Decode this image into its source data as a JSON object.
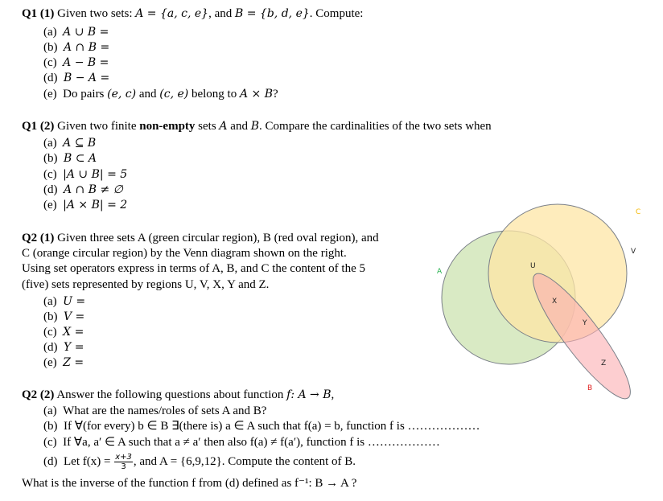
{
  "q1_1": {
    "heading_bold": "Q1 (1)",
    "heading_text": " Given two sets: ",
    "set_a": "A = {a, c, e}",
    "set_join": ", and ",
    "set_b": "B = {b, d, e}",
    "heading_tail": ". Compute:",
    "items": [
      {
        "label": "(a)",
        "expr": "A ∪ B ="
      },
      {
        "label": "(b)",
        "expr": "A ∩ B ="
      },
      {
        "label": "(c)",
        "expr": "A − B ="
      },
      {
        "label": "(d)",
        "expr": "B − A ="
      },
      {
        "label": "(e)",
        "text_pre": "Do pairs ",
        "pair1": "(e, c)",
        "text_mid": " and ",
        "pair2": "(c, e)",
        "text_post": " belong to ",
        "expr": "A × B",
        "end": "?"
      }
    ]
  },
  "q1_2": {
    "heading_bold": "Q1 (2)",
    "heading_text": " Given two finite ",
    "heading_emph": "non-empty",
    "heading_text2": " sets ",
    "var_a": "A",
    "and": " and ",
    "var_b": "B",
    "heading_tail": ". Compare the cardinalities  of the two sets when",
    "items": [
      {
        "label": "(a)",
        "expr": "A ⊆ B"
      },
      {
        "label": "(b)",
        "expr": "B ⊂ A"
      },
      {
        "label": "(c)",
        "expr": "|A ∪ B| = 5"
      },
      {
        "label": "(d)",
        "expr": "A ∩ B ≠ ∅"
      },
      {
        "label": "(e)",
        "expr": "|A × B| =  2"
      }
    ]
  },
  "q2_1": {
    "heading_bold": "Q2 (1)",
    "line1": " Given three sets A (green circular region),  B (red oval region),  and",
    "line2": "C (orange circular  region) by the Venn diagram  shown on the right.",
    "line3": "Using set operators express in terms of A, B, and C the content of the 5",
    "line4": "(five) sets represented by regions  U, V, X, Y and Z.",
    "items": [
      {
        "label": "(a)",
        "expr": "U ="
      },
      {
        "label": "(b)",
        "expr": "V ="
      },
      {
        "label": "(c)",
        "expr": "X ="
      },
      {
        "label": "(d)",
        "expr": "Y ="
      },
      {
        "label": "(e)",
        "expr": "Z ="
      }
    ]
  },
  "venn": {
    "sets": [
      {
        "name": "A",
        "description": "green circular region",
        "fill": "#d9eac4",
        "label_color": "#22b04b"
      },
      {
        "name": "B",
        "description": "red oval region",
        "fill": "#fcaeb0",
        "label_color": "#e0201f"
      },
      {
        "name": "C",
        "description": "orange circular region",
        "fill": "#fde6a6",
        "label_color": "#f5b800"
      }
    ],
    "regions": [
      "U",
      "V",
      "X",
      "Y",
      "Z"
    ],
    "outline_color": "#7a7f88"
  },
  "q2_2": {
    "heading_bold": "Q2 (2)",
    "heading_text": " Answer the following  questions about function ",
    "func": "f: A → B",
    "heading_tail": ",",
    "item_a": {
      "label": "(a)",
      "text": "What are the names/roles  of sets A and B?"
    },
    "item_b": {
      "label": "(b)",
      "text": "If ∀(for every) b ∈ B ∃(there is) a ∈ A such that f(a)  = b, function f is ",
      "blank": "………………"
    },
    "item_c": {
      "label": "(c)",
      "text": "If ∀a, a′ ∈ A such that a ≠ a′ then also f(a) ≠ f(a′), function f is ",
      "blank": "………………"
    },
    "item_d": {
      "label": "(d)",
      "pre": "Let f(x) = ",
      "num": "x+3",
      "den": "3",
      "post": ", and A = {6,9,12}. Compute the content of B."
    },
    "final": "What is the inverse  of the function  f  from (d) defined as f⁻¹: B → A ?"
  }
}
